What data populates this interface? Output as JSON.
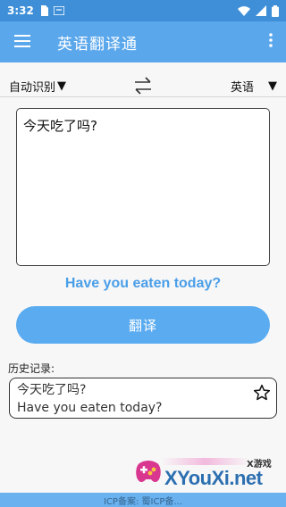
{
  "status_bar": {
    "time": "3:32"
  },
  "app_bar": {
    "title": "英语翻译通"
  },
  "languages": {
    "source": "自动识别",
    "target": "英语"
  },
  "input": {
    "text": "今天吃了吗?"
  },
  "result": {
    "text": "Have you eaten today?"
  },
  "translate_button": {
    "label": "翻译"
  },
  "history": {
    "label": "历史记录:",
    "items": [
      {
        "source": "今天吃了吗?",
        "translation": "Have you eaten today?"
      }
    ]
  },
  "footer": {
    "text": "ICP备案: 蜀ICP备..."
  },
  "watermark": {
    "brand": "XYouXi.net",
    "sub": "X游戏"
  },
  "colors": {
    "status_bar": "#3e8fd8",
    "app_bar": "#5aa7ec",
    "accent": "#4a9ee8",
    "button": "#5aabf0"
  }
}
